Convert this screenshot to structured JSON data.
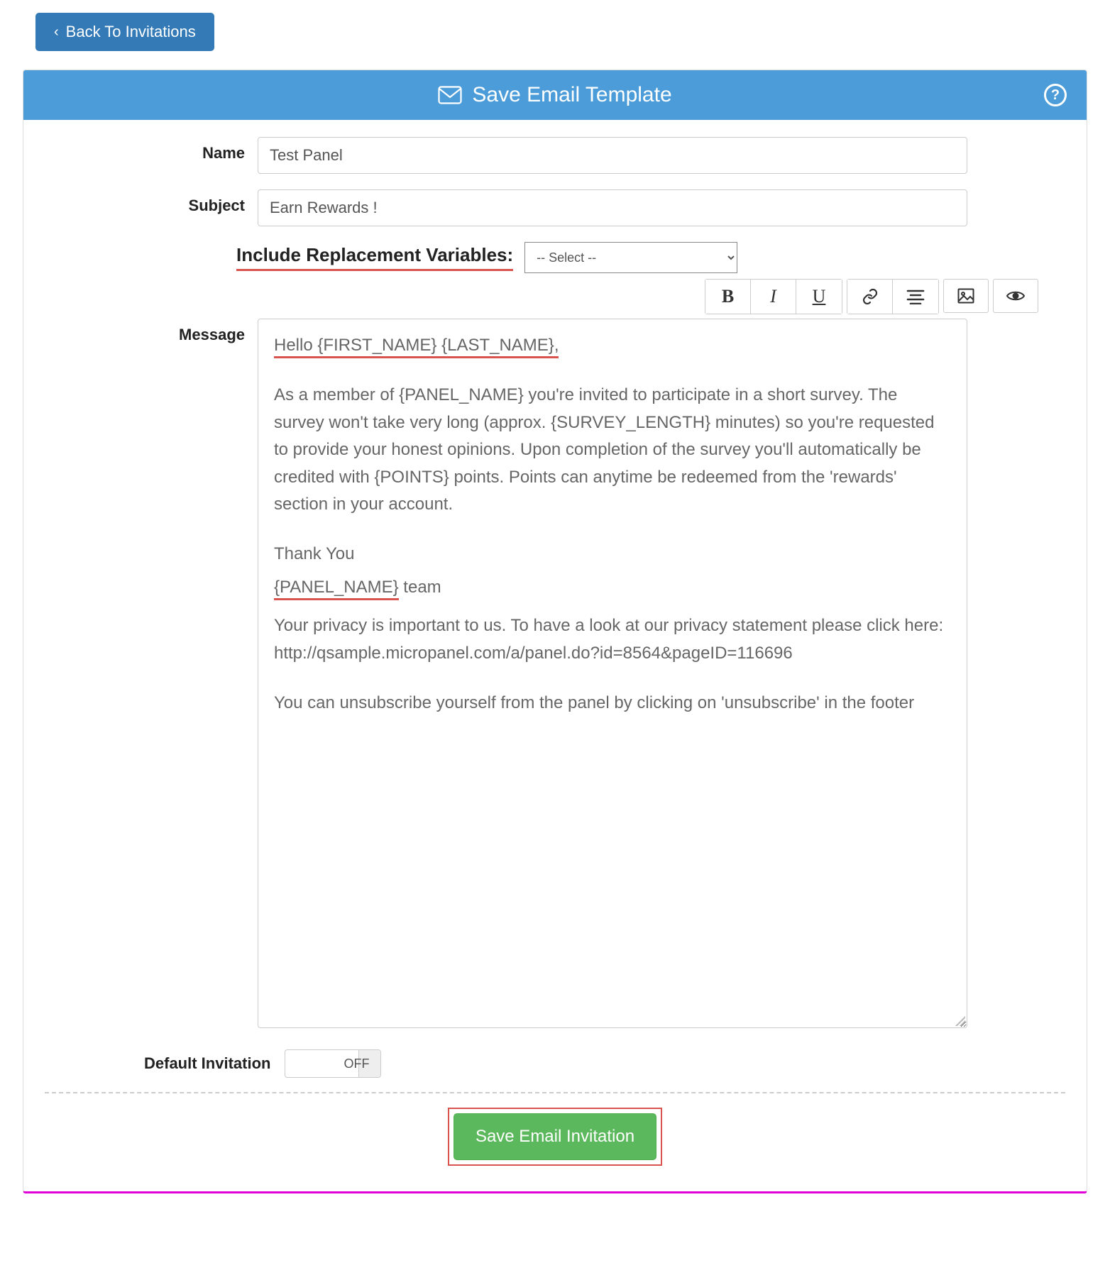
{
  "back_button": {
    "label": "Back To Invitations"
  },
  "header": {
    "title": "Save Email Template"
  },
  "form": {
    "name_label": "Name",
    "name_value": "Test Panel",
    "subject_label": "Subject",
    "subject_value": "Earn Rewards !",
    "replacement_vars_label": "Include Replacement Variables:",
    "replacement_vars_selected": "-- Select --",
    "message_label": "Message",
    "message": {
      "line1": "Hello {FIRST_NAME} {LAST_NAME},",
      "para1": "As a member of {PANEL_NAME} you're invited to participate in a short survey. The survey won't take very long (approx. {SURVEY_LENGTH} minutes) so you're requested to provide your honest opinions. Upon completion of the survey you'll automatically be credited with {POINTS} points. Points can anytime be redeemed from the 'rewards' section in your account.",
      "thank_you": "Thank You",
      "signature": "{PANEL_NAME}",
      "signature_suffix": " team",
      "privacy": "Your privacy is important to us. To have a look at our privacy statement please click here: http://qsample.micropanel.com/a/panel.do?id=8564&pageID=116696",
      "unsubscribe": "You can unsubscribe yourself from the panel by clicking on 'unsubscribe' in the footer"
    },
    "default_invitation_label": "Default Invitation",
    "default_invitation_state": "OFF",
    "save_button_label": "Save Email Invitation"
  }
}
